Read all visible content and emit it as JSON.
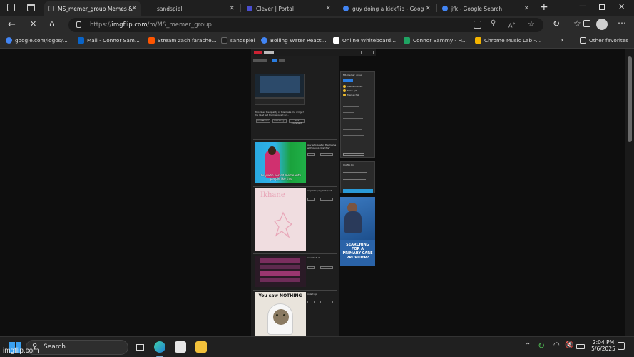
{
  "browser": {
    "tabs": [
      {
        "title": "MS_memer_group Memes &",
        "active": true,
        "favicon_color": "#2f2f2f"
      },
      {
        "title": "sandspiel",
        "active": false,
        "favicon_color": "#1f1f1f"
      },
      {
        "title": "Clever | Portal",
        "active": false,
        "favicon_color": "#4a4ecf"
      },
      {
        "title": "guy doing a kickflip - Googl",
        "active": false,
        "favicon_color": "#4285f4"
      },
      {
        "title": "jfk - Google Search",
        "active": false,
        "favicon_color": "#4285f4"
      }
    ],
    "url_prefix": "https://",
    "url_domain": "imgflip.com",
    "url_path": "/m/MS_memer_group",
    "favorites": [
      {
        "label": "google.com/logos/...",
        "color": "#4285f4"
      },
      {
        "label": "Mail - Connor Sam...",
        "color": "#0a64c8"
      },
      {
        "label": "Stream zach farache...",
        "color": "#ff5500"
      },
      {
        "label": "sandspiel",
        "color": "#1f1f1f"
      },
      {
        "label": "Boiling Water React...",
        "color": "#4285f4"
      },
      {
        "label": "Online Whiteboard...",
        "color": "#ffffff"
      },
      {
        "label": "Connor Sammy - H...",
        "color": "#1fa463"
      },
      {
        "label": "Chrome Music Lab -...",
        "color": "#f4b400"
      }
    ],
    "other_favorites": "Other favorites"
  },
  "page": {
    "first_post_question": "Who does the quality of this make me cringe? the I just get them allowed w/...",
    "buttons": [
      "Add Meme",
      "Add Image",
      "Post Comment"
    ],
    "posts": [
      {
        "title": "guy who posted the meme with people like this?",
        "caption": "Guy who posted meme with people like this"
      },
      {
        "title": "regarding my last post",
        "caption": "Ikhane"
      },
      {
        "title": "reposted, r1",
        "caption": ""
      },
      {
        "title": "rolled up",
        "caption": "You saw NOTHING"
      }
    ],
    "sidebar_heading": "MS_memer_group",
    "sidebar_links": [
      "Meme memes",
      "Make gif",
      "Meme chat"
    ],
    "imgflip_pro_heading": "Imgflip Pro",
    "ad_text": "SEARCHING FOR A PRIMARY CARE PROVIDER?"
  },
  "taskbar": {
    "search_placeholder": "Search",
    "time": "2:04 PM",
    "date": "5/6/2025"
  },
  "watermark": "imgflip.com"
}
